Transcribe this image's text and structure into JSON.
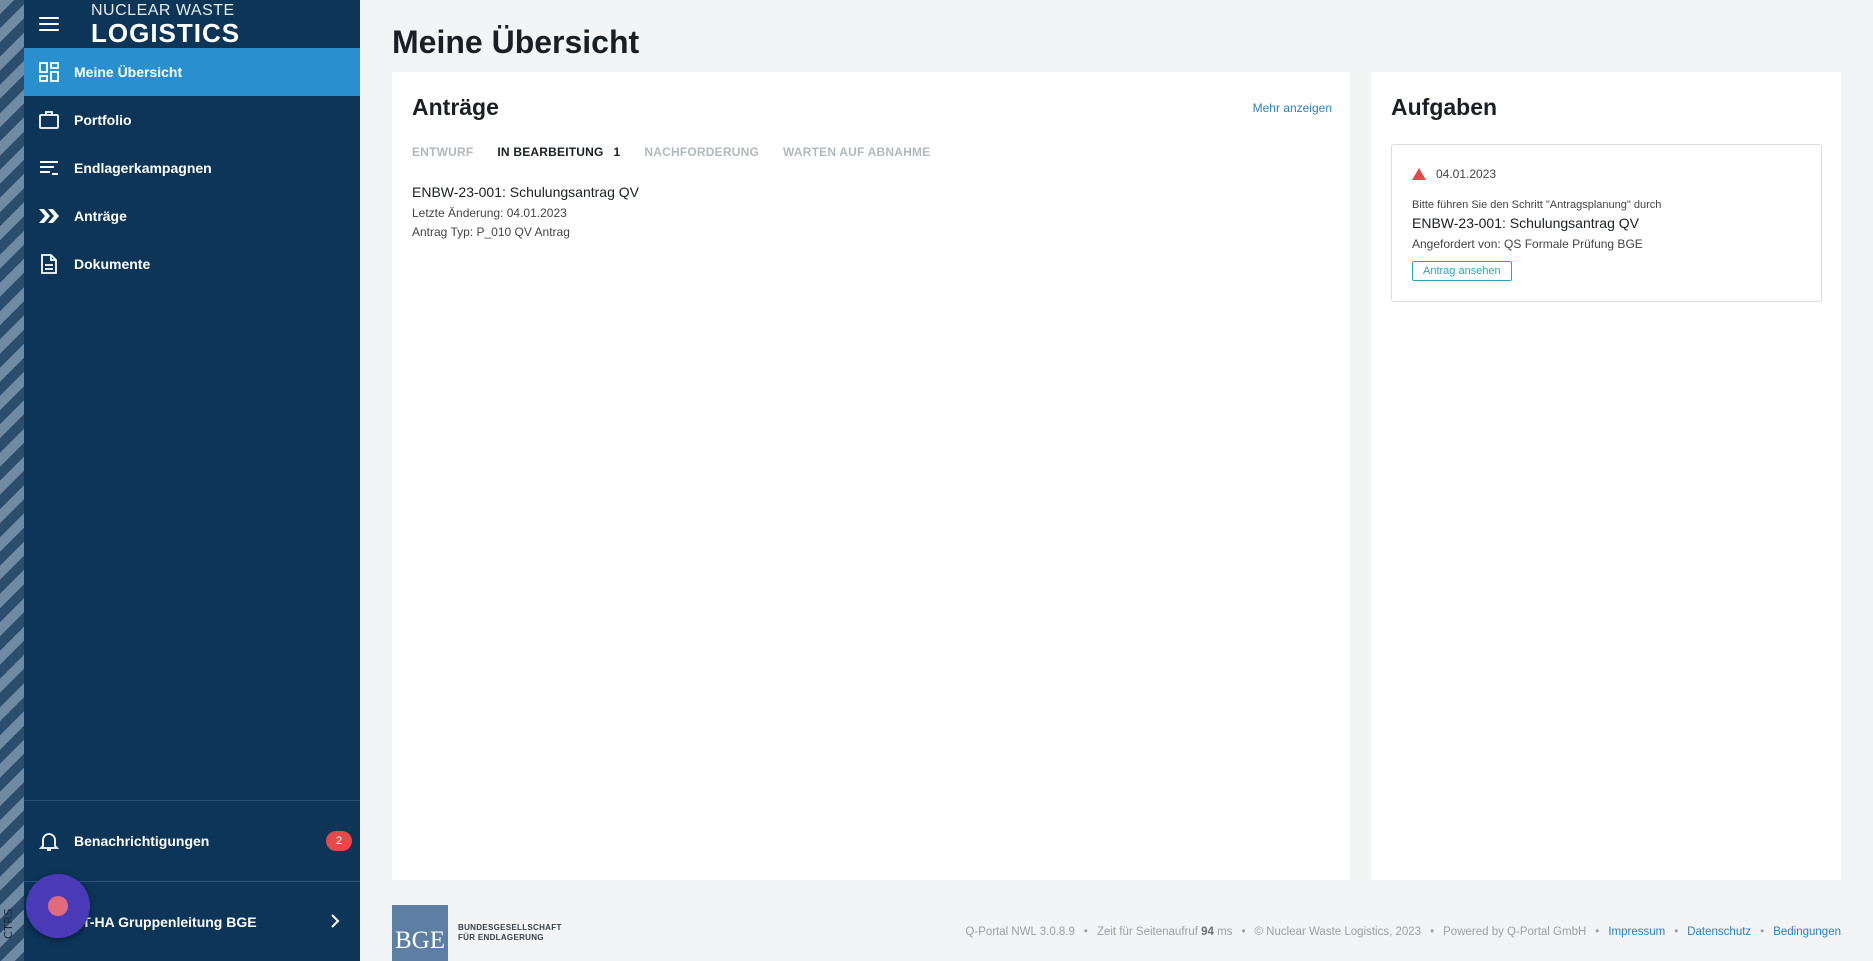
{
  "env": {
    "label": "CTRS"
  },
  "brand": {
    "line1": "NUCLEAR WASTE",
    "line2": "LOGISTICS"
  },
  "nav": {
    "items": [
      {
        "label": "Meine Übersicht",
        "icon": "dashboard-icon",
        "active": true
      },
      {
        "label": "Portfolio",
        "icon": "briefcase-icon"
      },
      {
        "label": "Endlagerkampagnen",
        "icon": "list-icon"
      },
      {
        "label": "Anträge",
        "icon": "double-chevron-icon"
      },
      {
        "label": "Dokumente",
        "icon": "document-icon"
      }
    ]
  },
  "notifications": {
    "label": "Benachrichtigungen",
    "count": "2"
  },
  "account": {
    "name": "KT-HA Gruppenleitung BGE"
  },
  "page": {
    "title": "Meine Übersicht"
  },
  "antraege": {
    "title": "Anträge",
    "more": "Mehr anzeigen",
    "tabs": [
      {
        "label": "ENTWURF",
        "count": ""
      },
      {
        "label": "IN BEARBEITUNG",
        "count": "1",
        "active": true
      },
      {
        "label": "NACHFORDERUNG",
        "count": ""
      },
      {
        "label": "WARTEN AUF ABNAHME",
        "count": ""
      }
    ],
    "item": {
      "title": "ENBW-23-001: Schulungsantrag QV",
      "changed": "Letzte Änderung: 04.01.2023",
      "type": "Antrag Typ: P_010 QV Antrag"
    }
  },
  "aufgaben": {
    "title": "Aufgaben",
    "task": {
      "date": "04.01.2023",
      "instruction": "Bitte führen Sie den Schritt \"Antragsplanung\" durch",
      "title": "ENBW-23-001: Schulungsantrag QV",
      "requested": "Angefordert von: QS Formale Prüfung BGE",
      "button": "Antrag ansehen"
    }
  },
  "footer": {
    "bge": {
      "mark": "BGE",
      "line1": "BUNDESGESELLSCHAFT",
      "line2": "FÜR ENDLAGERUNG"
    },
    "version": "Q-Portal NWL 3.0.8.9",
    "load_prefix": "Zeit für Seitenaufruf",
    "load_value": "94",
    "load_unit": "ms",
    "copyright": "© Nuclear Waste Logistics, 2023",
    "powered": "Powered by Q-Portal GmbH",
    "links": {
      "impressum": "Impressum",
      "datenschutz": "Datenschutz",
      "bedingungen": "Bedingungen"
    }
  },
  "colors": {
    "sidebar": "#0c3558",
    "accent": "#2a8fcf",
    "badge": "#e34a4a",
    "warn": "#e34a4a",
    "button": "#26a6b8"
  }
}
